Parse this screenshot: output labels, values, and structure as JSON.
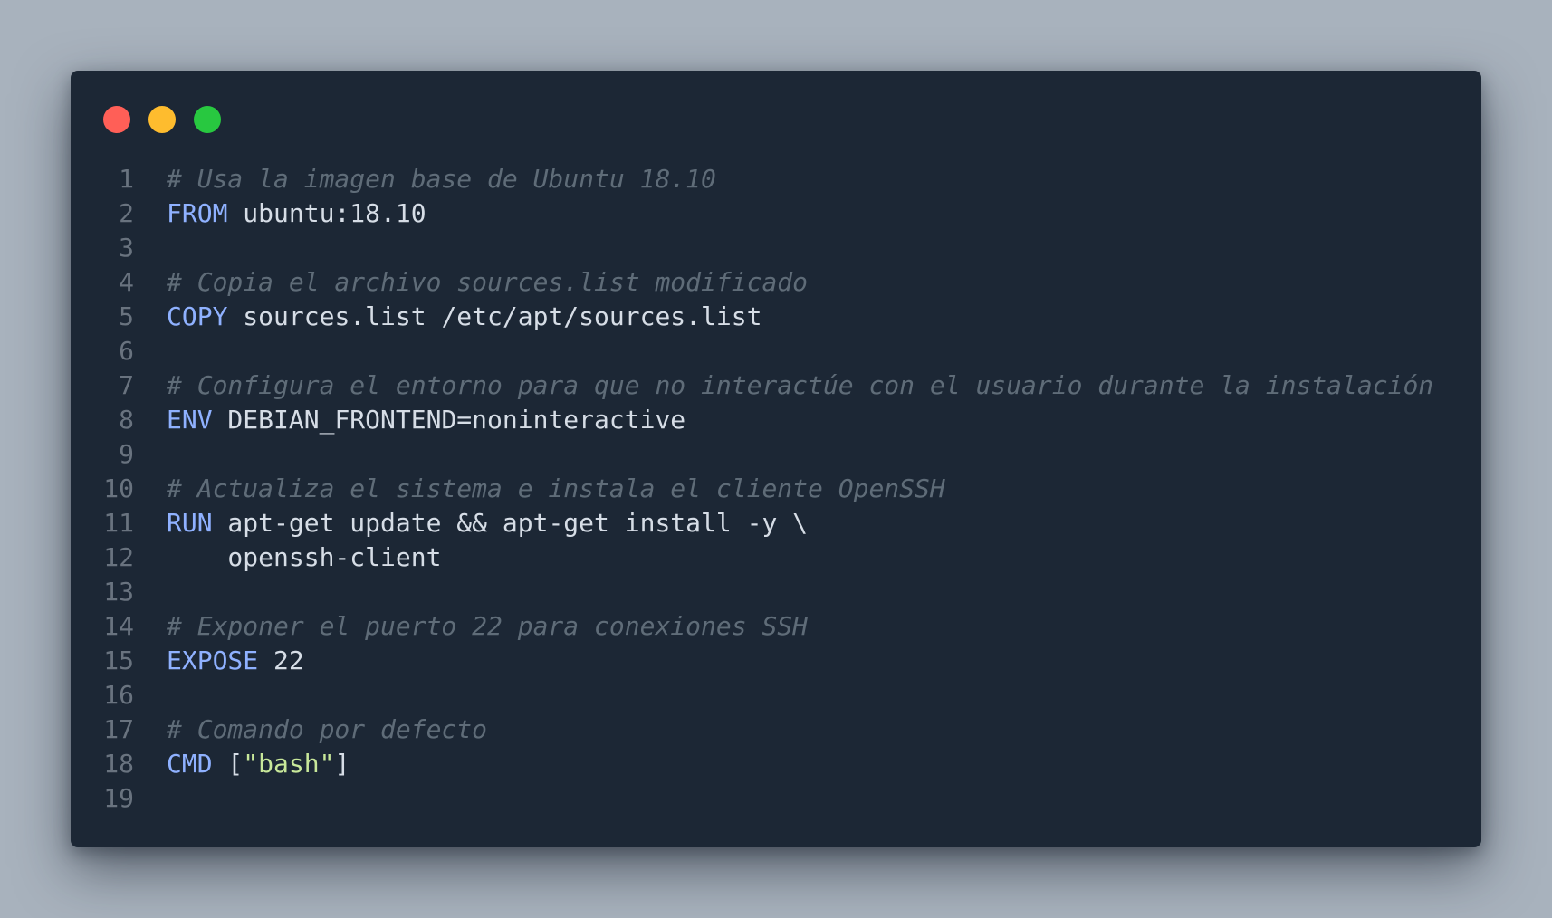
{
  "window": {
    "dots": [
      {
        "name": "close-dot",
        "color": "#ff5f57"
      },
      {
        "name": "minimize-dot",
        "color": "#febc2e"
      },
      {
        "name": "maximize-dot",
        "color": "#28c840"
      }
    ]
  },
  "colors": {
    "background": "#a8b2bd",
    "window": "#1c2735",
    "comment": "#5f6c78",
    "keyword": "#8fb1ff",
    "string": "#c8e89a",
    "text": "#d6dde6",
    "line_number": "#69737f"
  },
  "code": {
    "lines": [
      {
        "n": "1",
        "tokens": [
          {
            "t": "comment",
            "v": "# Usa la imagen base de Ubuntu 18.10"
          }
        ]
      },
      {
        "n": "2",
        "tokens": [
          {
            "t": "kw",
            "v": "FROM"
          },
          {
            "t": "txt",
            "v": " ubuntu:18.10"
          }
        ]
      },
      {
        "n": "3",
        "tokens": []
      },
      {
        "n": "4",
        "tokens": [
          {
            "t": "comment",
            "v": "# Copia el archivo sources.list modificado"
          }
        ]
      },
      {
        "n": "5",
        "tokens": [
          {
            "t": "kw",
            "v": "COPY"
          },
          {
            "t": "txt",
            "v": " sources.list /etc/apt/sources.list"
          }
        ]
      },
      {
        "n": "6",
        "tokens": []
      },
      {
        "n": "7",
        "tokens": [
          {
            "t": "comment",
            "v": "# Configura el entorno para que no interactúe con el usuario durante la instalación"
          }
        ]
      },
      {
        "n": "8",
        "tokens": [
          {
            "t": "kw",
            "v": "ENV"
          },
          {
            "t": "txt",
            "v": " DEBIAN_FRONTEND=noninteractive"
          }
        ]
      },
      {
        "n": "9",
        "tokens": []
      },
      {
        "n": "10",
        "tokens": [
          {
            "t": "comment",
            "v": "# Actualiza el sistema e instala el cliente OpenSSH"
          }
        ]
      },
      {
        "n": "11",
        "tokens": [
          {
            "t": "kw",
            "v": "RUN"
          },
          {
            "t": "txt",
            "v": " apt-get update && apt-get install -y \\"
          }
        ]
      },
      {
        "n": "12",
        "tokens": [
          {
            "t": "txt",
            "v": "    openssh-client"
          }
        ]
      },
      {
        "n": "13",
        "tokens": []
      },
      {
        "n": "14",
        "tokens": [
          {
            "t": "comment",
            "v": "# Exponer el puerto 22 para conexiones SSH"
          }
        ]
      },
      {
        "n": "15",
        "tokens": [
          {
            "t": "kw",
            "v": "EXPOSE"
          },
          {
            "t": "txt",
            "v": " 22"
          }
        ]
      },
      {
        "n": "16",
        "tokens": []
      },
      {
        "n": "17",
        "tokens": [
          {
            "t": "comment",
            "v": "# Comando por defecto"
          }
        ]
      },
      {
        "n": "18",
        "tokens": [
          {
            "t": "kw",
            "v": "CMD"
          },
          {
            "t": "txt",
            "v": " ["
          },
          {
            "t": "str",
            "v": "\"bash\""
          },
          {
            "t": "txt",
            "v": "]"
          }
        ]
      },
      {
        "n": "19",
        "tokens": []
      }
    ]
  }
}
